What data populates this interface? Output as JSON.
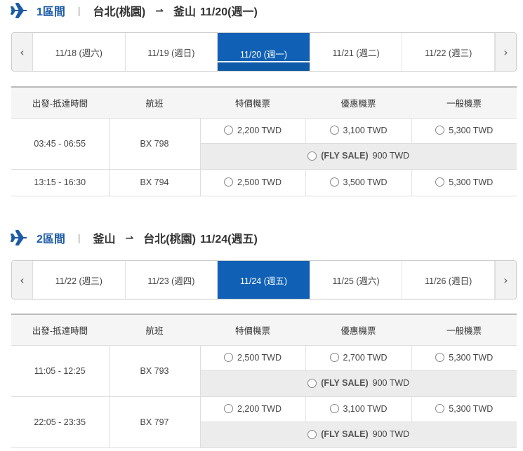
{
  "currency": "TWD",
  "legs": [
    {
      "leg_label": "1區間",
      "from": "台北(桃園)",
      "to": "釜山",
      "date": "11/20(週一)",
      "prev_icon": "chevron-left-icon",
      "next_icon": "chevron-right-icon",
      "dates": [
        "11/18 (週六)",
        "11/19 (週日)",
        "11/20 (週一)",
        "11/21 (週二)",
        "11/22 (週三)"
      ],
      "active_index": 2,
      "columns": [
        "出發-抵達時間",
        "航班",
        "特價機票",
        "優惠機票",
        "一般機票"
      ],
      "flights": [
        {
          "time": "03:45 - 06:55",
          "flight": "BX 798",
          "special": "2,200 TWD",
          "discount": "3,100 TWD",
          "normal": "5,300 TWD",
          "sale_label": "(FLY SALE)",
          "sale_price": "900 TWD"
        },
        {
          "time": "13:15 - 16:30",
          "flight": "BX 794",
          "special": "2,500 TWD",
          "discount": "3,500 TWD",
          "normal": "5,300 TWD"
        }
      ]
    },
    {
      "leg_label": "2區間",
      "from": "釜山",
      "to": "台北(桃園)",
      "date": "11/24(週五)",
      "prev_icon": "chevron-left-icon",
      "next_icon": "chevron-right-icon",
      "dates": [
        "11/22 (週三)",
        "11/23 (週四)",
        "11/24 (週五)",
        "11/25 (週六)",
        "11/26 (週日)"
      ],
      "active_index": 2,
      "columns": [
        "出發-抵達時間",
        "航班",
        "特價機票",
        "優惠機票",
        "一般機票"
      ],
      "flights": [
        {
          "time": "11:05 - 12:25",
          "flight": "BX 793",
          "special": "2,500 TWD",
          "discount": "2,700 TWD",
          "normal": "5,300 TWD",
          "sale_label": "(FLY SALE)",
          "sale_price": "900 TWD"
        },
        {
          "time": "22:05 - 23:35",
          "flight": "BX 797",
          "special": "2,200 TWD",
          "discount": "3,100 TWD",
          "normal": "5,300 TWD",
          "sale_label": "(FLY SALE)",
          "sale_price": "900 TWD"
        }
      ]
    }
  ],
  "ui": {
    "prev_glyph": "‹",
    "next_glyph": "›",
    "route_arrow": "⇀",
    "separator": "|"
  },
  "colors": {
    "brand_blue": "#1061b5",
    "header_bg": "#f5f5f5",
    "sale_bg": "#ececec"
  }
}
